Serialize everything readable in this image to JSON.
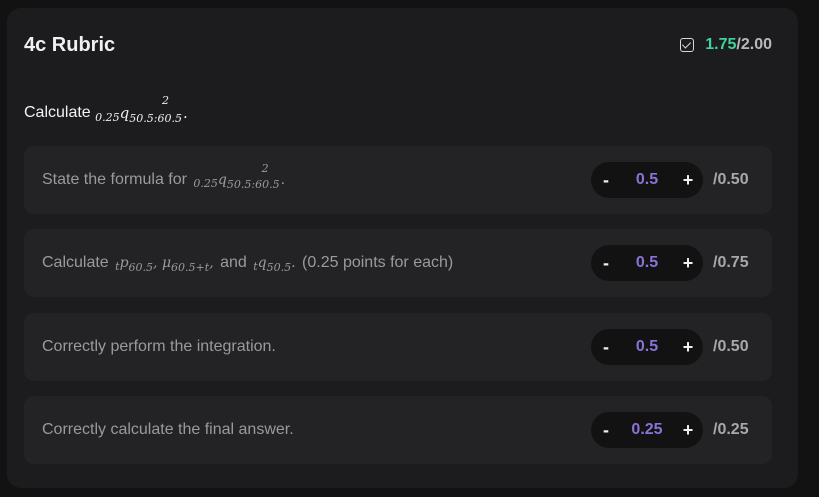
{
  "rubric": {
    "title": "4c Rubric",
    "score_earned": "1.75",
    "score_total": "/2.00",
    "prompt_prefix": "Calculate",
    "prompt_math": {
      "pre": "0.25",
      "symbol": "q",
      "up": "2",
      "sub": "50.5:60.5"
    },
    "items": [
      {
        "text_prefix": "State the formula for",
        "value": "0.5",
        "max": "/0.50"
      },
      {
        "text_prefix": "Calculate",
        "text_suffix": "(0.25 points for each)",
        "value": "0.5",
        "max": "/0.75"
      },
      {
        "text": "Correctly perform the integration.",
        "value": "0.5",
        "max": "/0.50"
      },
      {
        "text": "Correctly calculate the final answer.",
        "value": "0.25",
        "max": "/0.25"
      }
    ],
    "minus_label": "-",
    "plus_label": "+"
  },
  "colors": {
    "earned": "#3fd39b",
    "stepper_value": "#8b72d6",
    "panel": "#1c1c1e",
    "row": "#232325"
  }
}
